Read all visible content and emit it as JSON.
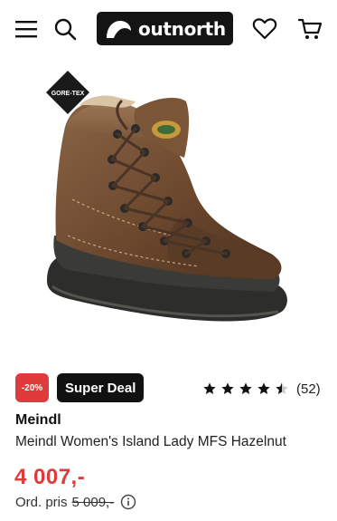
{
  "header": {
    "brand": "outnorth",
    "icons": [
      "menu-icon",
      "search-icon",
      "heart-icon",
      "cart-icon"
    ]
  },
  "hero": {
    "badge_text": "GORE-TEX"
  },
  "product": {
    "discount_badge": "-20%",
    "deal_badge": "Super Deal",
    "rating": 4.5,
    "review_count": "(52)",
    "brand": "Meindl",
    "name": "Meindl Women's Island Lady MFS Hazelnut",
    "price": "4 007,-",
    "ordinary_label": "Ord. pris",
    "ordinary_price": "5 009,-"
  },
  "colors": {
    "accent_red": "#e03a3a",
    "dark": "#141414"
  }
}
